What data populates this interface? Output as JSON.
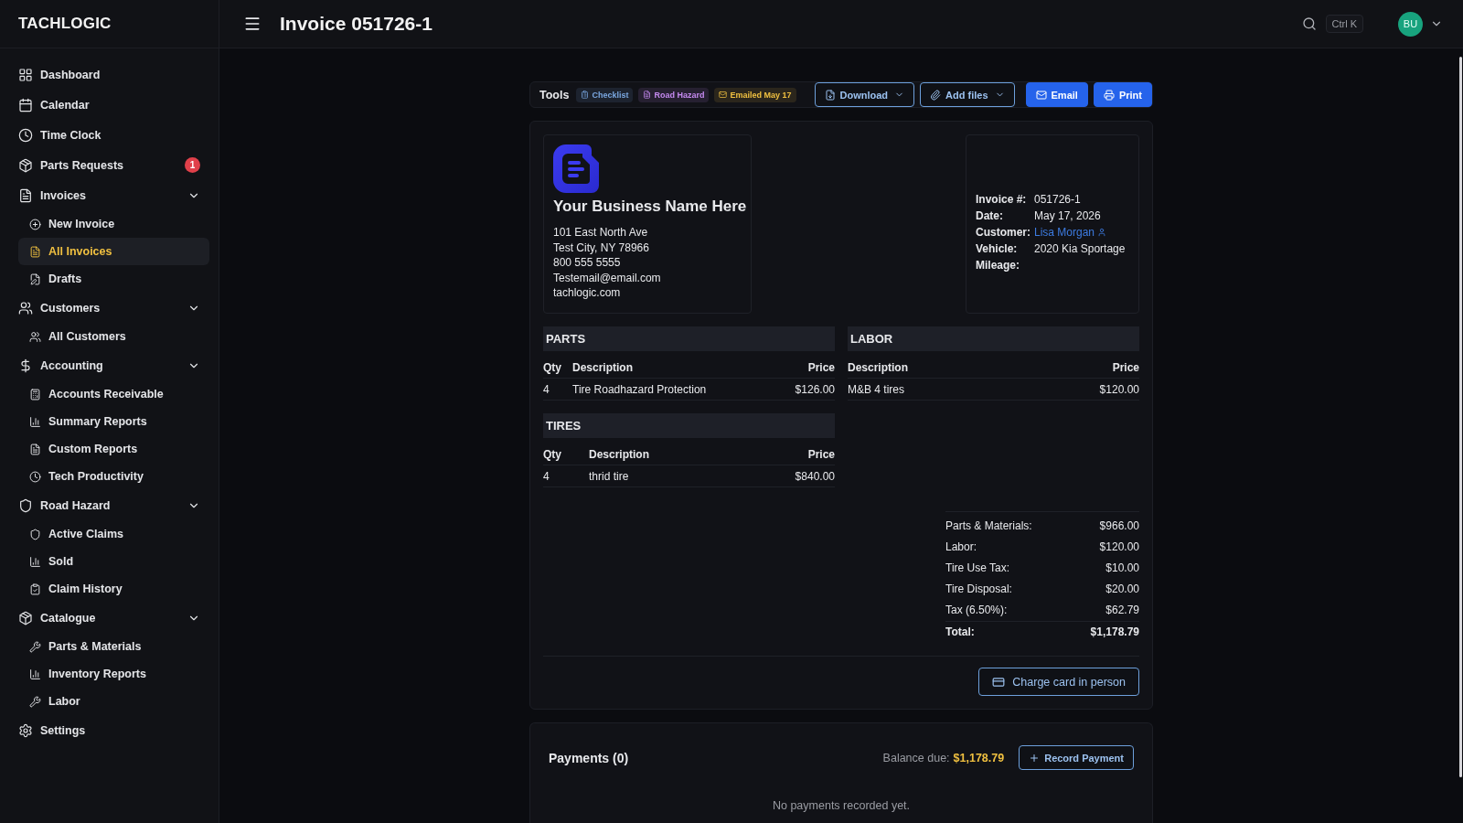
{
  "brand": "TACHLOGIC",
  "sidebar": {
    "items": [
      {
        "label": "Dashboard",
        "selected": false
      },
      {
        "label": "Calendar",
        "selected": false
      },
      {
        "label": "Time Clock",
        "selected": false
      },
      {
        "label": "Parts Requests",
        "selected": false,
        "badge": "1"
      },
      {
        "label": "Invoices",
        "selected": false,
        "expanded": true,
        "children": [
          {
            "label": "New Invoice",
            "selected": false
          },
          {
            "label": "All Invoices",
            "selected": true
          },
          {
            "label": "Drafts",
            "selected": false
          }
        ]
      },
      {
        "label": "Customers",
        "selected": false,
        "expanded": true,
        "children": [
          {
            "label": "All Customers",
            "selected": false
          }
        ]
      },
      {
        "label": "Accounting",
        "selected": false,
        "expanded": true,
        "children": [
          {
            "label": "Accounts Receivable",
            "selected": false
          },
          {
            "label": "Summary Reports",
            "selected": false
          },
          {
            "label": "Custom Reports",
            "selected": false
          },
          {
            "label": "Tech Productivity",
            "selected": false
          }
        ]
      },
      {
        "label": "Road Hazard",
        "selected": false,
        "expanded": true,
        "children": [
          {
            "label": "Active Claims",
            "selected": false
          },
          {
            "label": "Sold",
            "selected": false
          },
          {
            "label": "Claim History",
            "selected": false
          }
        ]
      },
      {
        "label": "Catalogue",
        "selected": false,
        "expanded": true,
        "children": [
          {
            "label": "Parts & Materials",
            "selected": false
          },
          {
            "label": "Inventory Reports",
            "selected": false
          },
          {
            "label": "Labor",
            "selected": false
          }
        ]
      },
      {
        "label": "Settings",
        "selected": false
      }
    ]
  },
  "header": {
    "title": "Invoice 051726-1",
    "shortcut": "Ctrl K",
    "avatar": "BU"
  },
  "tools": {
    "label": "Tools",
    "tags": [
      {
        "label": "Checklist",
        "color": "#7aa7e0"
      },
      {
        "label": "Road Hazard",
        "color": "#c58af0"
      },
      {
        "label": "Emailed May 17",
        "color": "#f0c040"
      }
    ],
    "buttons": [
      {
        "label": "Download",
        "kind": "outline",
        "dropdown": true
      },
      {
        "label": "Add files",
        "kind": "outline",
        "dropdown": true
      },
      {
        "label": "Email",
        "kind": "filled",
        "dropdown": false
      },
      {
        "label": "Print",
        "kind": "filled",
        "dropdown": false
      }
    ]
  },
  "business": {
    "name": "Your Business Name Here",
    "lines": [
      "101 East North Ave",
      "Test City, NY 78966",
      "800 555 5555",
      "Testemail@email.com",
      "tachlogic.com"
    ]
  },
  "info": [
    {
      "label": "Invoice #:",
      "value": "051726-1",
      "kind": "text"
    },
    {
      "label": "Date:",
      "value": "May 17, 2026",
      "kind": "text"
    },
    {
      "label": "Customer:",
      "value": "Lisa Morgan",
      "kind": "link"
    },
    {
      "label": "Vehicle:",
      "value": "2020 Kia Sportage",
      "kind": "text"
    },
    {
      "label": "Mileage:"
    }
  ],
  "parts": {
    "title": "PARTS",
    "columns": [
      "Qty",
      "Description",
      "Price"
    ],
    "rows": [
      [
        "4",
        "Tire Roadhazard Protection",
        "$126.00"
      ]
    ]
  },
  "tires": {
    "title": "TIRES",
    "columns": [
      "Qty",
      "Description",
      "Price"
    ],
    "rows": [
      [
        "4",
        "thrid tire",
        "$840.00"
      ]
    ]
  },
  "labor": {
    "title": "LABOR",
    "columns": [
      "Description",
      "Price"
    ],
    "rows": [
      [
        "M&B 4 tires",
        "$120.00"
      ]
    ]
  },
  "totals": [
    {
      "label": "Parts & Materials:",
      "value": "$966.00",
      "bold": false
    },
    {
      "label": "Labor:",
      "value": "$120.00",
      "bold": false
    },
    {
      "label": "Tire Use Tax:",
      "value": "$10.00",
      "bold": false
    },
    {
      "label": "Tire Disposal:",
      "value": "$20.00",
      "bold": false
    },
    {
      "label": "Tax (6.50%):",
      "value": "$62.79",
      "bold": false
    },
    {
      "label": "Total:",
      "value": "$1,178.79",
      "bold": true
    }
  ],
  "charge_button": "Charge card in person",
  "payments": {
    "title": "Payments (0)",
    "balance_label": "Balance due:",
    "balance": "$1,178.79",
    "button": "Record Payment",
    "empty": "No payments recorded yet."
  }
}
